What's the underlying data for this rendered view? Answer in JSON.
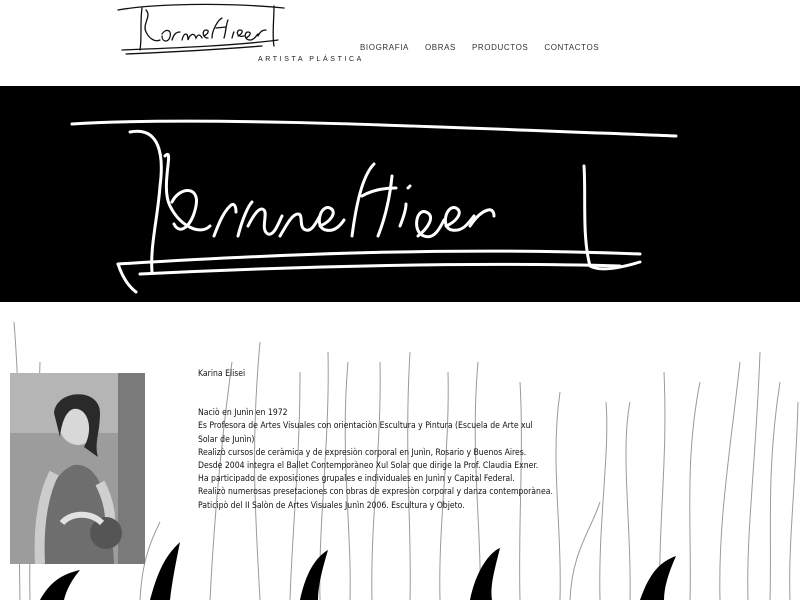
{
  "header": {
    "logo_subtitle": "ARTISTA PLÁSTICA"
  },
  "nav": {
    "items": [
      {
        "label": "BIOGRAFIA"
      },
      {
        "label": "OBRAS"
      },
      {
        "label": "PRODUCTOS"
      },
      {
        "label": "CONTACTOS"
      }
    ]
  },
  "bio": {
    "name": "Karina Elisei",
    "lines": [
      "Naciò en Junìn en 1972",
      "Es Profesora de Artes Visuales con orientaciòn Escultura y Pintura (Escuela de Arte xul Solar de Junìn)",
      "Realizò cursos de ceràmica y de expresiòn corporal en Junìn, Rosario y Buenos Aires.",
      "Desde 2004 integra el Ballet Contemporàneo Xul Solar que dirige la Prof. Claudia Exner.",
      "Ha participado de exposiciones grupales e individuales en Junìn y Capital Federal.",
      "Realizò numerosas presetaciones con obras de expresiòn corporal y danza contemporànea.",
      "Paticipò del II Salòn de Artes Visuales Junìn 2006. Escultura y Objeto."
    ]
  },
  "colors": {
    "banner_bg": "#000000",
    "page_bg": "#ffffff",
    "text": "#111111"
  }
}
